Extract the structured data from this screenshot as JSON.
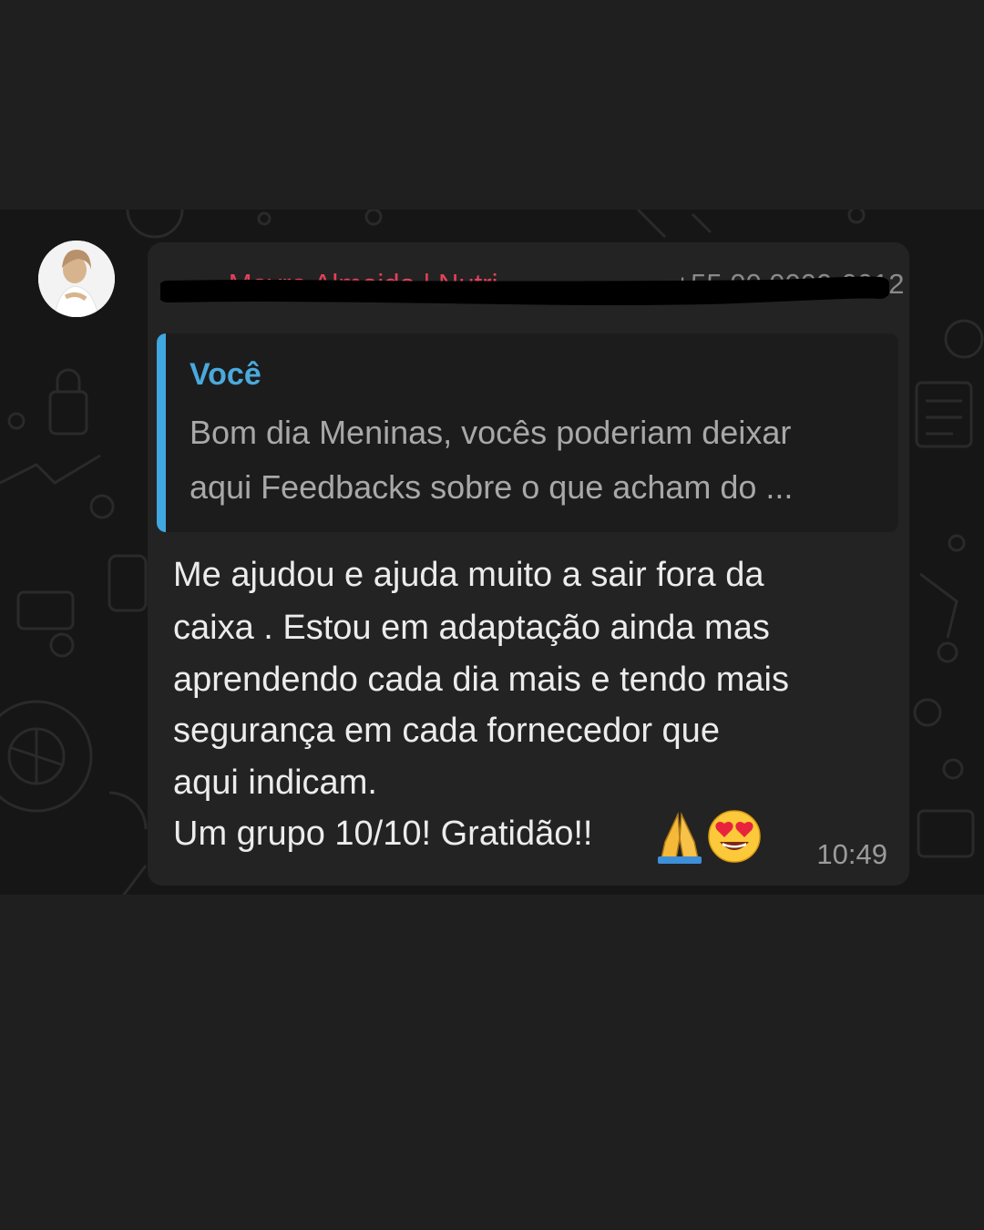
{
  "message": {
    "sender_name": "~ Mayra Almeida | Nutri",
    "sender_phone": "+55 00 0000-0012",
    "quoted": {
      "author": "Você",
      "lines": [
        "Bom dia Meninas, vocês poderiam deixar",
        "aqui Feedbacks sobre o que acham do ..."
      ]
    },
    "body_lines": [
      "Me ajudou e ajuda muito a sair fora da",
      "caixa . Estou em adaptação ainda mas",
      "aprendendo cada dia mais e tendo mais",
      "segurança em cada fornecedor que",
      "aqui indicam.",
      "Um grupo 10/10! Gratidão!!"
    ],
    "emojis": [
      "folded-hands-icon",
      "heart-eyes-face-icon"
    ],
    "time": "10:49"
  },
  "colors": {
    "page_bg": "#1f1f1f",
    "chat_bg": "#161616",
    "bubble_bg": "#232323",
    "sender_name": "#e2415a",
    "quote_accent": "#41a7e0",
    "quote_author": "#4aa9dd",
    "body_text": "#ececec",
    "meta_text": "#9b9b9b"
  }
}
